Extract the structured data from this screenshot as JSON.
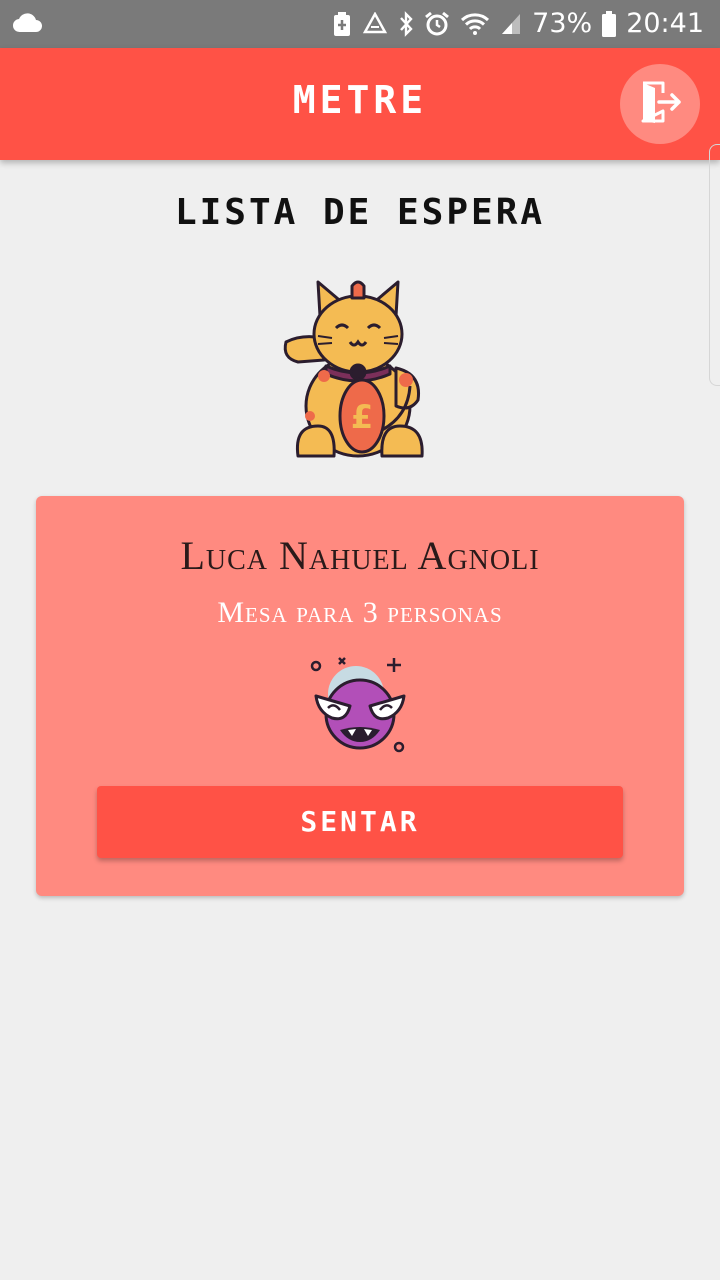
{
  "status_bar": {
    "battery_percent": "73%",
    "time": "20:41",
    "icons": [
      "cloud-icon",
      "battery-saver-icon",
      "recycle-icon",
      "bluetooth-icon",
      "alarm-icon",
      "wifi-icon",
      "signal-icon",
      "battery-icon"
    ]
  },
  "app_bar": {
    "title": "METRE",
    "exit_icon": "exit-door-icon",
    "primary_color": "#ff5246"
  },
  "page": {
    "heading": "LISTA DE ESPERA",
    "illustration": "lucky-cat-icon"
  },
  "waitlist": {
    "card_color": "#ff8a80",
    "items": [
      {
        "name": "Luca Nahuel Agnoli",
        "subtitle": "Mesa para 3 personas",
        "avatar": "purple-monster-icon",
        "action_label": "SENTAR"
      }
    ]
  }
}
